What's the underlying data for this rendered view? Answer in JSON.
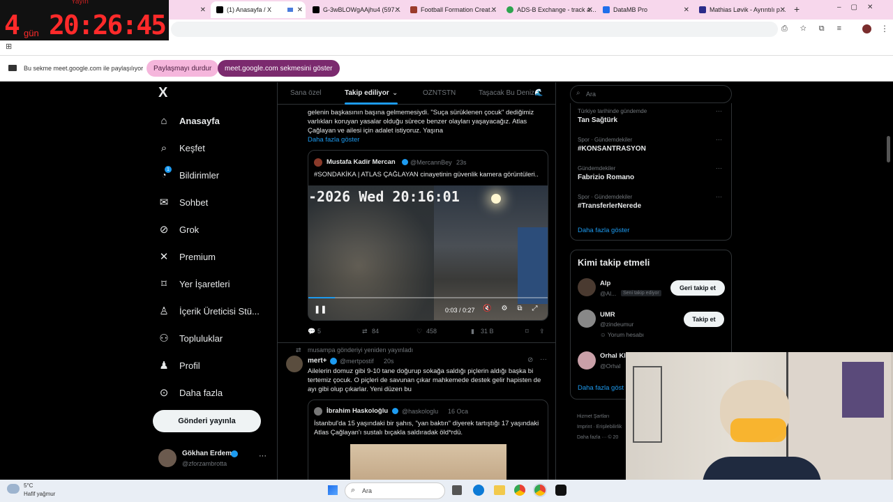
{
  "timer": {
    "label": "Yayın",
    "days": "4",
    "days_unit": "gün",
    "time": "20:26:45"
  },
  "browser": {
    "tabs": [
      {
        "title": "(1) Anasayfa / X",
        "color": "#000000"
      },
      {
        "title": "G-3wBLOWgAAjhu4 (597…",
        "color": "#000000"
      },
      {
        "title": "Football Formation Creat…",
        "color": "#9b3b2b"
      },
      {
        "title": "ADS-B Exchange - track a…",
        "color": "#2ea44f"
      },
      {
        "title": "DataMB Pro",
        "color": "#1f6feb"
      },
      {
        "title": "Mathias Løvik - Ayrıntılı p…",
        "color": "#2b2b8a"
      }
    ],
    "new_tab": "+"
  },
  "share": {
    "message": "Bu sekme meet.google.com ile paylaşılıyor",
    "stop": "Paylaşmayı durdur",
    "show": "meet.google.com sekmesini göster"
  },
  "sidebar": {
    "logo": "X",
    "items": [
      {
        "label": "Anasayfa",
        "icon": "home-icon",
        "glyph": "⌂"
      },
      {
        "label": "Keşfet",
        "icon": "search-icon",
        "glyph": "⌕"
      },
      {
        "label": "Bildirimler",
        "icon": "bell-icon",
        "glyph": "🔔",
        "badge": "1"
      },
      {
        "label": "Sohbet",
        "icon": "mail-icon",
        "glyph": "✉"
      },
      {
        "label": "Grok",
        "icon": "grok-icon",
        "glyph": "⊘"
      },
      {
        "label": "Premium",
        "icon": "x-premium-icon",
        "glyph": "✕"
      },
      {
        "label": "Yer İşaretleri",
        "icon": "bookmark-icon",
        "glyph": "⌑"
      },
      {
        "label": "İçerik Üreticisi Stü...",
        "icon": "creator-studio-icon",
        "glyph": "♙"
      },
      {
        "label": "Topluluklar",
        "icon": "communities-icon",
        "glyph": "⚇"
      },
      {
        "label": "Profil",
        "icon": "profile-icon",
        "glyph": "♟"
      },
      {
        "label": "Daha fazla",
        "icon": "more-circle-icon",
        "glyph": "⊙"
      }
    ],
    "post_button": "Gönderi yayınla",
    "user": {
      "name": "Gökhan Erdem",
      "handle": "@zforzambrotta",
      "more": "···"
    }
  },
  "feed": {
    "tabs": [
      "Sana özel",
      "Takip ediliyor",
      "OZNTSTN",
      "Taşacak Bu Deniz🌊"
    ],
    "post1": {
      "text": "gelenin başkasının başına gelmemesiydi. \"Suça sürüklenen çocuk\" dediğimiz varlıkları koruyan yasalar olduğu sürece benzer olayları yaşayacağız. Atlas Çağlayan ve ailesi için adalet istiyoruz. Yaşına",
      "show_more": "Daha fazla göster",
      "quote": {
        "name": "Mustafa Kadir Mercan",
        "handle": "@MercannBey",
        "time": "23s",
        "text": "#SONDAKİKA | ATLAS ÇAĞLAYAN cinayetinin güvenlik kamera görüntüleri..",
        "video_overlay": "-2026 Wed 20:16:01",
        "video_time": "0:03 / 0:27"
      },
      "stats": {
        "replies": "5",
        "reposts": "84",
        "likes": "458",
        "views": "31 B"
      }
    },
    "post2": {
      "repost_by": "musampa gönderiyi yeniden yayınladı",
      "name": "mert+",
      "handle": "@mertpostif",
      "time": "20s",
      "text": "Ailelerin domuz gibi 9-10 tane doğurup sokağa saldığı piçlerin aldığı başka bi tertemiz çocuk. O piçleri de savunan çıkar mahkemede destek gelir hapisten de ayı gibi olup çıkarlar. Yeni düzen bu",
      "quote": {
        "name": "İbrahim Haskoloğlu",
        "handle": "@haskologlu",
        "time": "16 Oca",
        "text": "İstanbul'da 15 yaşındaki bir şahıs, \"yan baktın\" diyerek tartıştığı 17 yaşındaki Atlas Çağlayan'ı sustalı bıçakla saldıradak öld*rdü."
      }
    }
  },
  "right": {
    "search_placeholder": "Ara",
    "trends": [
      {
        "meta": "Türkiye tarihinde gündemde",
        "title": "Tan Sağtürk"
      },
      {
        "meta": "Spor · Gündemdekiler",
        "title": "#KONSANTRASYON"
      },
      {
        "meta": "Gündemdekiler",
        "title": "Fabrizio Romano"
      },
      {
        "meta": "Spor · Gündemdekiler",
        "title": "#TransferlerNerede"
      }
    ],
    "trends_more": "Daha fazla göster",
    "who_title": "Kimi takip etmeli",
    "who": [
      {
        "name": "Alp",
        "handle": "@Al...",
        "extra": "Seni takip ediyor",
        "button": "Geri takip et"
      },
      {
        "name": "UMR",
        "handle": "@zindeumur",
        "extra": "Yorum hesabı",
        "button": "Takip et"
      },
      {
        "name": "Orhal Kl",
        "handle": "@Orhal",
        "extra": "",
        "button": ""
      }
    ],
    "who_more": "Daha fazla göst",
    "footer": [
      "Hizmet Şartları",
      "Imprint",
      "Erişilebilirlik",
      "Daha fazla ··· © 20"
    ]
  },
  "taskbar": {
    "search": "Ara",
    "weather": "Hafif yağmur",
    "temp": "5°C"
  },
  "colors": {
    "accent": "#1d9bf0",
    "share_pink": "#f5b6dc",
    "share_purple": "#7b2a6e",
    "timer_red": "#ff2a2a"
  }
}
